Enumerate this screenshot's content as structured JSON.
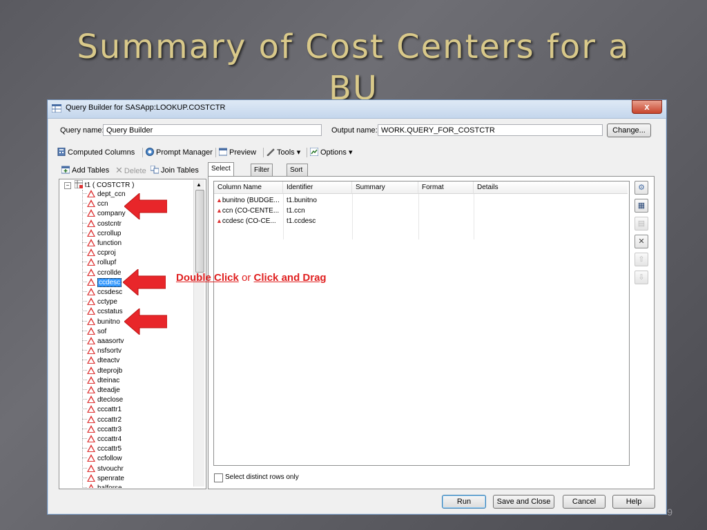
{
  "slide": {
    "title": "Summary of Cost Centers for a BU",
    "page_number": "9"
  },
  "window": {
    "title": "Query Builder for SASApp:LOOKUP.COSTCTR",
    "close_label": "x"
  },
  "query": {
    "name_label": "Query name:",
    "name_value": "Query Builder",
    "output_label": "Output name:",
    "output_value": "WORK.QUERY_FOR_COSTCTR",
    "change_button": "Change..."
  },
  "toolbar": {
    "computed_columns": "Computed Columns",
    "prompt_manager": "Prompt Manager",
    "preview": "Preview",
    "tools": "Tools",
    "options": "Options"
  },
  "left_toolbar": {
    "add_tables": "Add Tables",
    "delete": "Delete",
    "join_tables": "Join Tables"
  },
  "tree": {
    "root": "t1 ( COSTCTR )",
    "items": [
      "dept_ccn",
      "ccn",
      "company",
      "costcntr",
      "ccrollup",
      "function",
      "ccproj",
      "rollupf",
      "ccrollde",
      "ccdesc",
      "ccsdesc",
      "cctype",
      "ccstatus",
      "bunitno",
      "sof",
      "aaasortv",
      "nsfsortv",
      "dteactv",
      "dteprojb",
      "dteinac",
      "dteadje",
      "dteclose",
      "cccattr1",
      "cccattr2",
      "cccattr3",
      "cccattr4",
      "cccattr5",
      "ccfollow",
      "stvouchr",
      "spenrate",
      "balforse"
    ],
    "selected": "ccdesc"
  },
  "tabs": [
    "Select Data",
    "Filter Data",
    "Sort Data"
  ],
  "grid": {
    "headers": [
      "Column Name",
      "Identifier",
      "Summary",
      "Format",
      "Details"
    ],
    "rows": [
      {
        "column_name": "bunitno (BUDGE...",
        "identifier": "t1.bunitno"
      },
      {
        "column_name": "ccn (CO-CENTE...",
        "identifier": "t1.ccn"
      },
      {
        "column_name": "ccdesc (CO-CE...",
        "identifier": "t1.ccdesc"
      }
    ]
  },
  "annotation": {
    "double_click": "Double Click",
    "or": "or",
    "click_drag": "Click and Drag"
  },
  "distinct_label": "Select distinct rows only",
  "footer": {
    "run": "Run",
    "save_close": "Save and Close",
    "cancel": "Cancel",
    "help": "Help"
  },
  "colors": {
    "title_text": "#d9c98a",
    "annotation": "#e02020",
    "arrow": "#e8262a",
    "selection": "#3399ff"
  }
}
